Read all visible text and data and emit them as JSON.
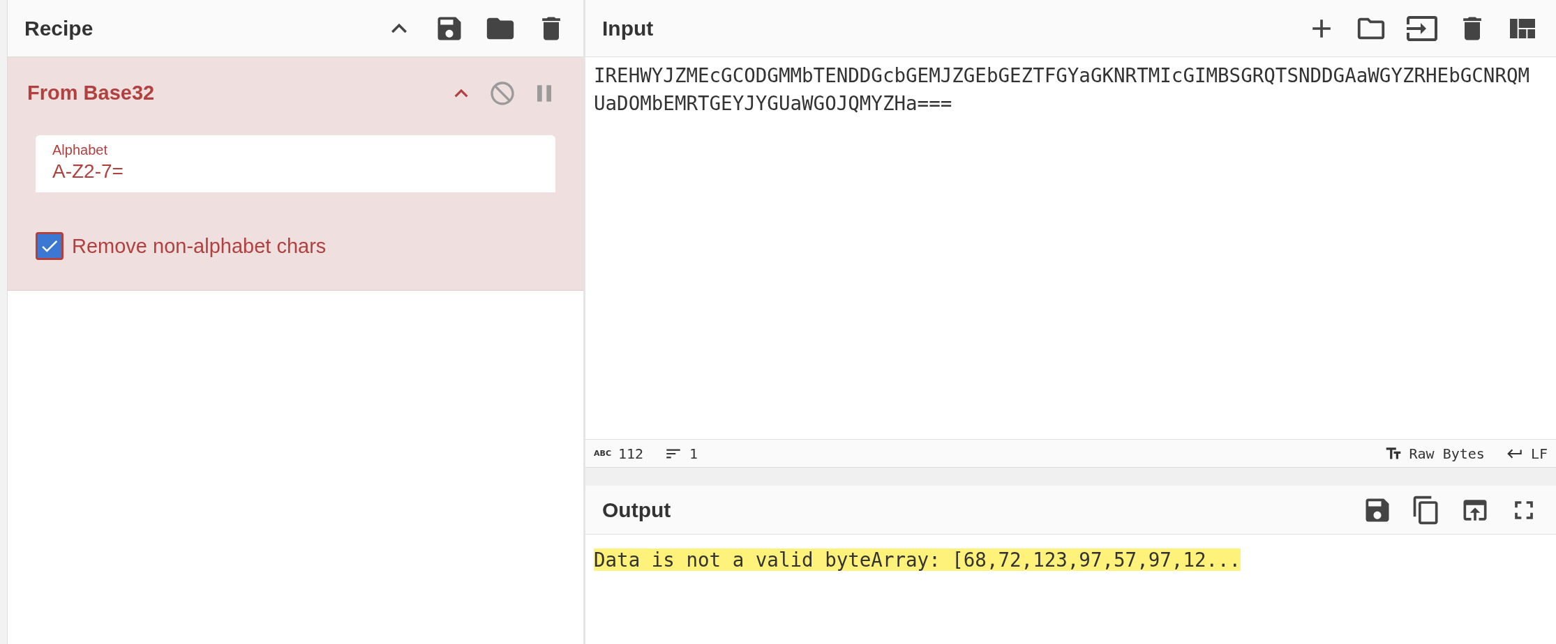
{
  "recipe": {
    "title": "Recipe",
    "operations": [
      {
        "name": "From Base32",
        "args": [
          {
            "kind": "field",
            "label": "Alphabet",
            "value": "A-Z2-7="
          },
          {
            "kind": "checkbox",
            "label": "Remove non-alphabet chars",
            "checked": true
          }
        ]
      }
    ]
  },
  "input": {
    "title": "Input",
    "text": "IREHWYJZMEcGCODGMMbTENDDGcbGEMJZGEbGEZTFGYaGKNRTMIcGIMBSGRQTSNDDGAaWGYZRHEbGCNRQMUaDOMbEMRTGEYJYGUaWGOJQMYZHa===",
    "status": {
      "length_icon": "ABC",
      "length": "112",
      "lines": "1",
      "encoding": "Raw Bytes",
      "eol": "LF"
    }
  },
  "output": {
    "title": "Output",
    "text": "Data is not a valid byteArray: [68,72,123,97,57,97,12..."
  }
}
